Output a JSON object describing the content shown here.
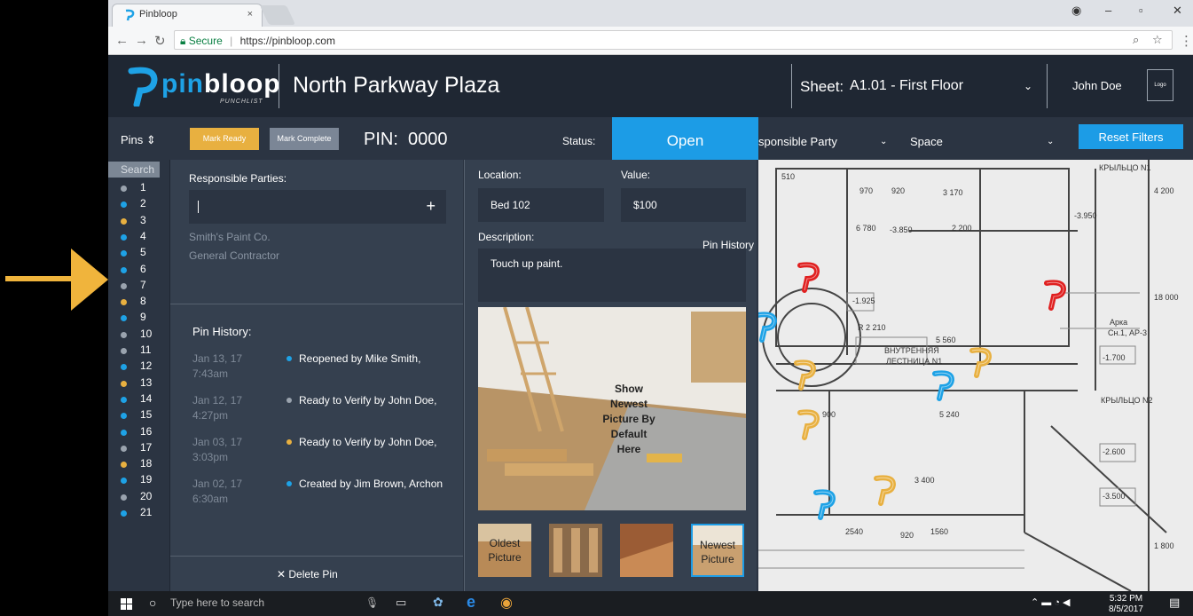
{
  "browser": {
    "tab_title": "Pinbloop",
    "tab_close": "×",
    "secure_label": "Secure",
    "url": "https://pinbloop.com"
  },
  "header": {
    "logo_text_1": "pin",
    "logo_text_2": "bloop",
    "logo_sub": "PUNCHLIST",
    "project_name": "North Parkway Plaza",
    "sheet_label": "Sheet:",
    "sheet_value": "A1.01 - First Floor",
    "user_name": "John Doe",
    "user_logo": "Logo"
  },
  "toolbar": {
    "pins_label": "Pins",
    "mark_ready": "Mark Ready",
    "mark_complete": "Mark Complete",
    "pin_label": "PIN:  0000",
    "status_label": "Status:",
    "status_value": "Open",
    "filter_responsible": "sponsible Party",
    "filter_space": "Space",
    "reset_filters": "Reset Filters"
  },
  "sidebar": {
    "search_label": "Search",
    "pins": [
      {
        "num": "1",
        "color": "#9aa3ae"
      },
      {
        "num": "2",
        "color": "#1ea2e6"
      },
      {
        "num": "3",
        "color": "#e8b040"
      },
      {
        "num": "4",
        "color": "#1ea2e6"
      },
      {
        "num": "5",
        "color": "#1ea2e6"
      },
      {
        "num": "6",
        "color": "#1ea2e6"
      },
      {
        "num": "7",
        "color": "#9aa3ae"
      },
      {
        "num": "8",
        "color": "#e8b040"
      },
      {
        "num": "9",
        "color": "#1ea2e6"
      },
      {
        "num": "10",
        "color": "#9aa3ae"
      },
      {
        "num": "11",
        "color": "#9aa3ae"
      },
      {
        "num": "12",
        "color": "#1ea2e6"
      },
      {
        "num": "13",
        "color": "#e8b040"
      },
      {
        "num": "14",
        "color": "#1ea2e6"
      },
      {
        "num": "15",
        "color": "#1ea2e6"
      },
      {
        "num": "16",
        "color": "#1ea2e6"
      },
      {
        "num": "17",
        "color": "#9aa3ae"
      },
      {
        "num": "18",
        "color": "#e8b040"
      },
      {
        "num": "19",
        "color": "#1ea2e6"
      },
      {
        "num": "20",
        "color": "#9aa3ae"
      },
      {
        "num": "21",
        "color": "#1ea2e6"
      }
    ]
  },
  "detail": {
    "responsible_title": "Responsible Parties:",
    "plus": "+",
    "parties": [
      "Smith's Paint Co.",
      "General Contractor"
    ],
    "history_title": "Pin History:",
    "history": [
      {
        "date": "Jan 13, 17",
        "time": "7:43am",
        "text": "Reopened by Mike Smith,",
        "color": "#1ea2e6"
      },
      {
        "date": "Jan 12, 17",
        "time": "4:27pm",
        "text": "Ready to Verify by John Doe,",
        "color": "#9aa3ae"
      },
      {
        "date": "Jan 03, 17",
        "time": "3:03pm",
        "text": "Ready to Verify by John Doe,",
        "color": "#e8b040"
      },
      {
        "date": "Jan 02, 17",
        "time": "6:30am",
        "text": "Created by Jim Brown, Archon",
        "color": "#1ea2e6"
      }
    ],
    "delete_pin": "✕  Delete Pin"
  },
  "mid": {
    "location_label": "Location:",
    "location_value": "Bed 102",
    "value_label": "Value:",
    "value_value": "$100",
    "description_label": "Description:",
    "description_value": "Touch up paint.",
    "pin_history_label": "Pin History",
    "photo_caption_1": "Show",
    "photo_caption_2": "Newest",
    "photo_caption_3": "Picture By",
    "photo_caption_4": "Default",
    "photo_caption_5": "Here",
    "thumb_oldest_1": "Oldest",
    "thumb_oldest_2": "Picture",
    "thumb_newest_1": "Newest",
    "thumb_newest_2": "Picture"
  },
  "map": {
    "labels": [
      "510",
      "970",
      "920",
      "3 170",
      "6 780",
      "-3.850",
      "2 200",
      "-3.950",
      "-1.925",
      "R 2 210",
      "5 560",
      "ВНУТРЕННЯЯ",
      "ЛЕСТНИЦА N1",
      "-1.700",
      "Арка",
      "Сн.1, АР-3",
      "КРЫЛЬЦО N2",
      "5 240",
      "900",
      "-2.600",
      "2540",
      "920",
      "1560",
      "-3.500",
      "3 400",
      "18 000",
      "4 200",
      "1 800",
      "КРЫЛЬЦО N1"
    ]
  },
  "taskbar": {
    "search_placeholder": "Type here to search",
    "time": "5:32 PM",
    "date": "8/5/2017"
  }
}
